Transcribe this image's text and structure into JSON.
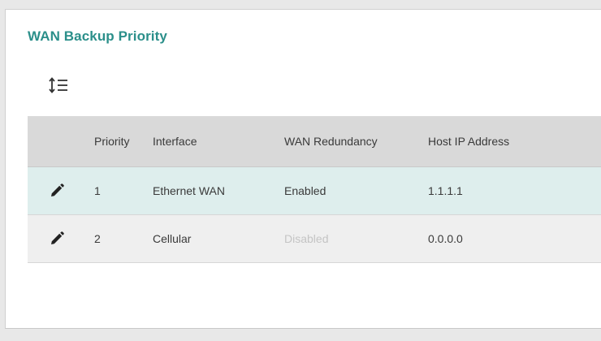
{
  "panel": {
    "title": "WAN Backup Priority"
  },
  "toolbar": {
    "sort_icon": "sort-list-icon"
  },
  "table": {
    "columns": [
      "Priority",
      "Interface",
      "WAN Redundancy",
      "Host IP Address"
    ],
    "rows": [
      {
        "priority": "1",
        "interface": "Ethernet WAN",
        "wan_redundancy": "Enabled",
        "host_ip": "1.1.1.1",
        "edit_icon": "pencil-icon",
        "selected": true
      },
      {
        "priority": "2",
        "interface": "Cellular",
        "wan_redundancy": "Disabled",
        "host_ip": "0.0.0.0",
        "edit_icon": "pencil-icon",
        "selected": false
      }
    ]
  },
  "colors": {
    "accent": "#2b8f8a",
    "header_bg": "#d9d9d9",
    "selected_row_bg": "#deeeed",
    "disabled_text": "#c4c4c4"
  }
}
